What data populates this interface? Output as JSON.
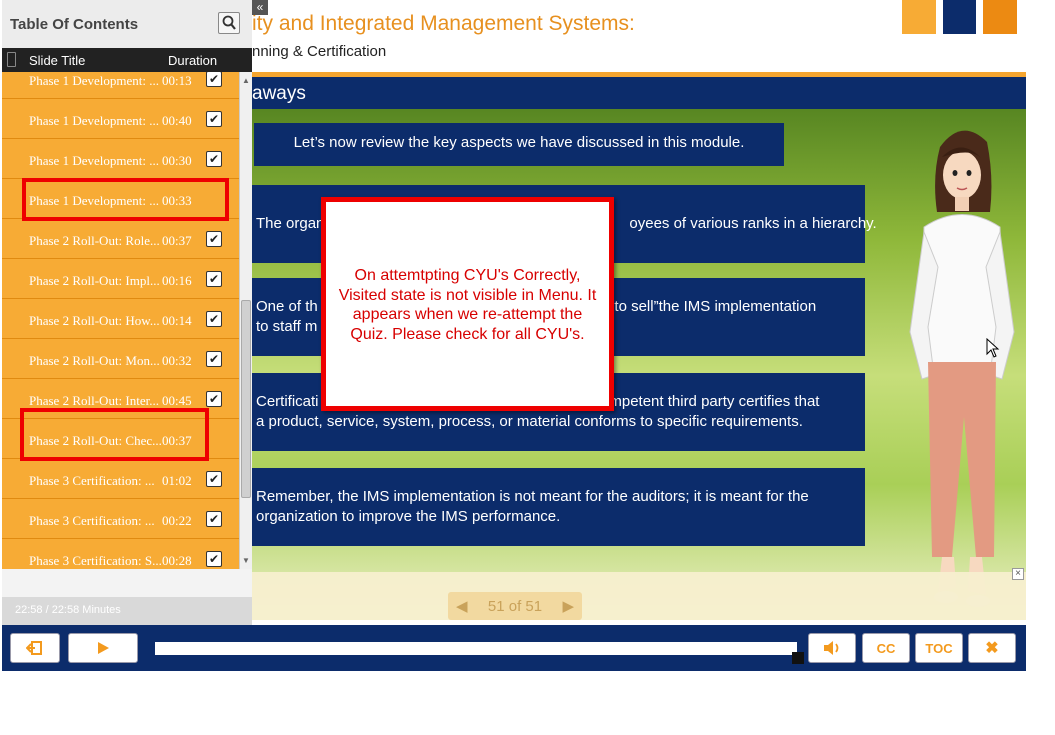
{
  "header": {
    "title": "ity and Integrated Management Systems:",
    "subtitle": "nning & Certification",
    "squares": [
      "#f7ab35",
      "#0c2c6b",
      "#ec8a12"
    ]
  },
  "slide": {
    "heading": "aways",
    "intro": "Let’s now review the key aspects we have discussed in this module.",
    "points": [
      "The organ………………………………………………… oyees of various ranks in a hierarchy.",
      "One of th…………………………………………… now to sell”the IMS implementation",
      "Certificati…………………………………………… competent third party certifies that",
      "Remember, the IMS implementation is not meant for the auditors; it is meant for the organization to improve the IMS performance."
    ],
    "points_full": [
      "The organ",
      "oyees of various ranks in a hierarchy.",
      "One of th",
      "to staff m",
      "now to sell”the IMS implementation",
      "Certificati",
      "competent third party certifies that",
      "a product, service, system, process, or material conforms to specific requirements."
    ],
    "page_indicator": "51 of 51"
  },
  "popup": {
    "text": "On attemtpting CYU's Correctly, Visited state is not visible in Menu. It appears when we re-attempt the Quiz. Please check for all CYU's."
  },
  "sidebar": {
    "title": "Table Of Contents",
    "col_title": "Slide Title",
    "col_duration": "Duration",
    "footer": "22:58 / 22:58 Minutes",
    "rows": [
      {
        "title": "Phase 1 Development: ...",
        "duration": "00:13",
        "checked": true
      },
      {
        "title": "Phase 1 Development: ...",
        "duration": "00:40",
        "checked": true
      },
      {
        "title": "Phase 1 Development: ...",
        "duration": "00:30",
        "checked": true
      },
      {
        "title": "Phase 1 Development: ...",
        "duration": "00:33",
        "checked": false
      },
      {
        "title": "Phase 2 Roll-Out: Role...",
        "duration": "00:37",
        "checked": true
      },
      {
        "title": "Phase 2 Roll-Out: Impl...",
        "duration": "00:16",
        "checked": true
      },
      {
        "title": "Phase 2 Roll-Out: How...",
        "duration": "00:14",
        "checked": true
      },
      {
        "title": "Phase 2 Roll-Out: Mon...",
        "duration": "00:32",
        "checked": true
      },
      {
        "title": "Phase 2 Roll-Out: Inter...",
        "duration": "00:45",
        "checked": true
      },
      {
        "title": "Phase 2 Roll-Out: Chec...",
        "duration": "00:37",
        "checked": false
      },
      {
        "title": "Phase 3 Certification: ...",
        "duration": "01:02",
        "checked": true
      },
      {
        "title": "Phase 3 Certification: ...",
        "duration": "00:22",
        "checked": true
      },
      {
        "title": "Phase 3 Certification: S...",
        "duration": "00:28",
        "checked": true
      }
    ]
  },
  "controls": {
    "cc": "CC",
    "toc": "TOC",
    "progress_fraction": 1.0
  }
}
